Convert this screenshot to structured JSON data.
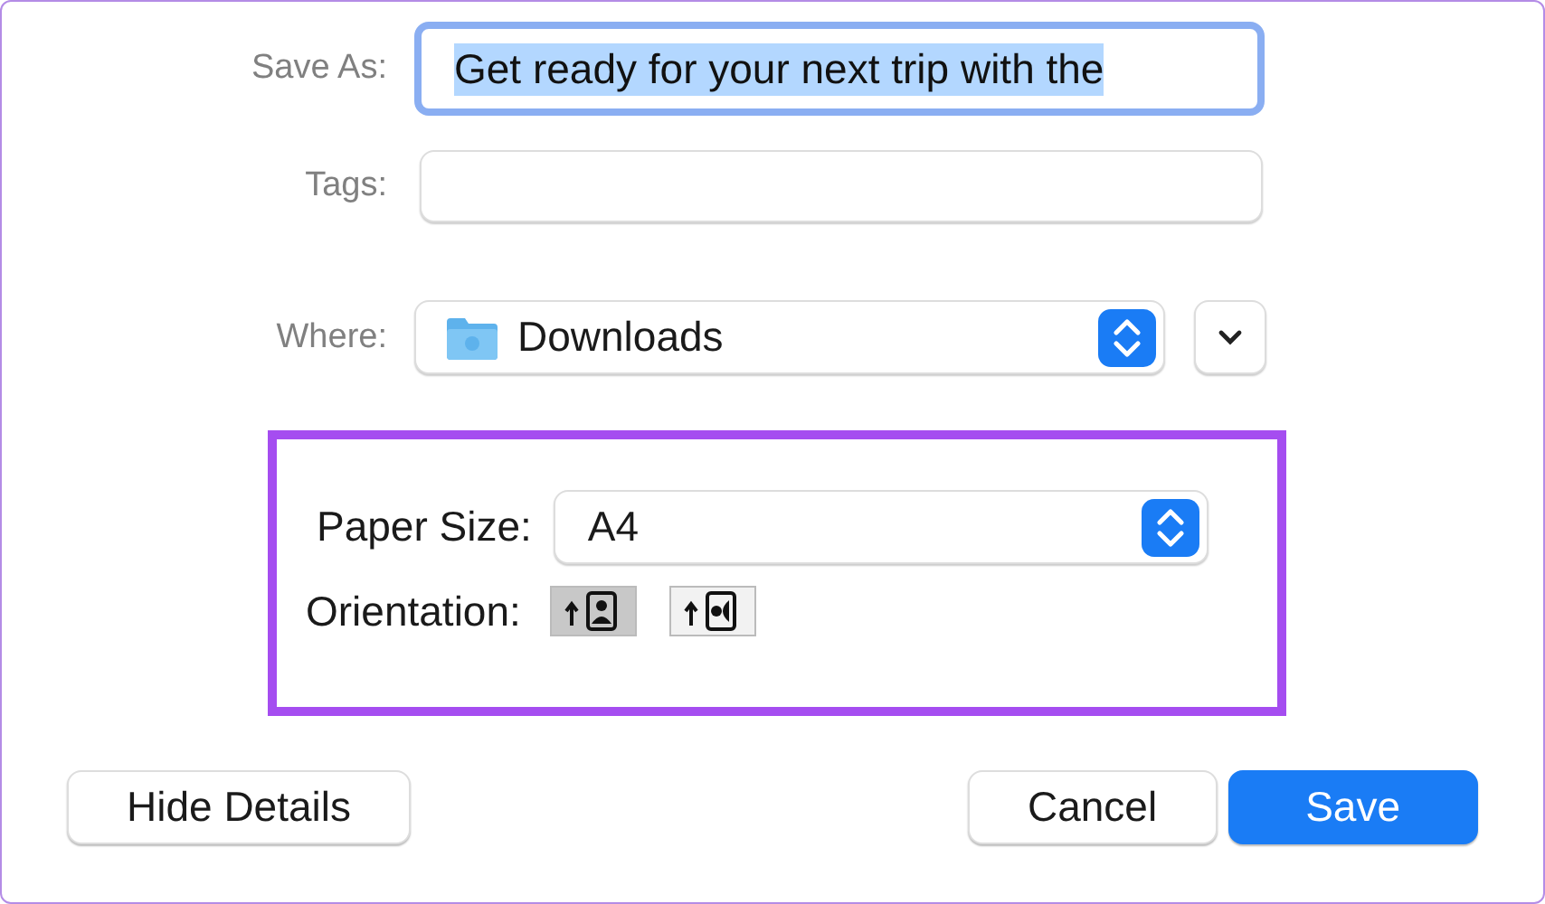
{
  "save_as": {
    "label": "Save As:",
    "value": "Get ready for your next trip with the",
    "selected": true
  },
  "tags": {
    "label": "Tags:"
  },
  "where": {
    "label": "Where:",
    "value": "Downloads"
  },
  "details": {
    "paper_size": {
      "label": "Paper Size:",
      "value": "A4"
    },
    "orientation": {
      "label": "Orientation:",
      "options": [
        {
          "kind": "portrait",
          "selected": true
        },
        {
          "kind": "landscape",
          "selected": false
        }
      ]
    }
  },
  "buttons": [
    {
      "label": "Hide Details",
      "kind": "plain"
    },
    {
      "label": "Cancel",
      "kind": "plain"
    },
    {
      "label": "Save",
      "kind": "default"
    }
  ]
}
